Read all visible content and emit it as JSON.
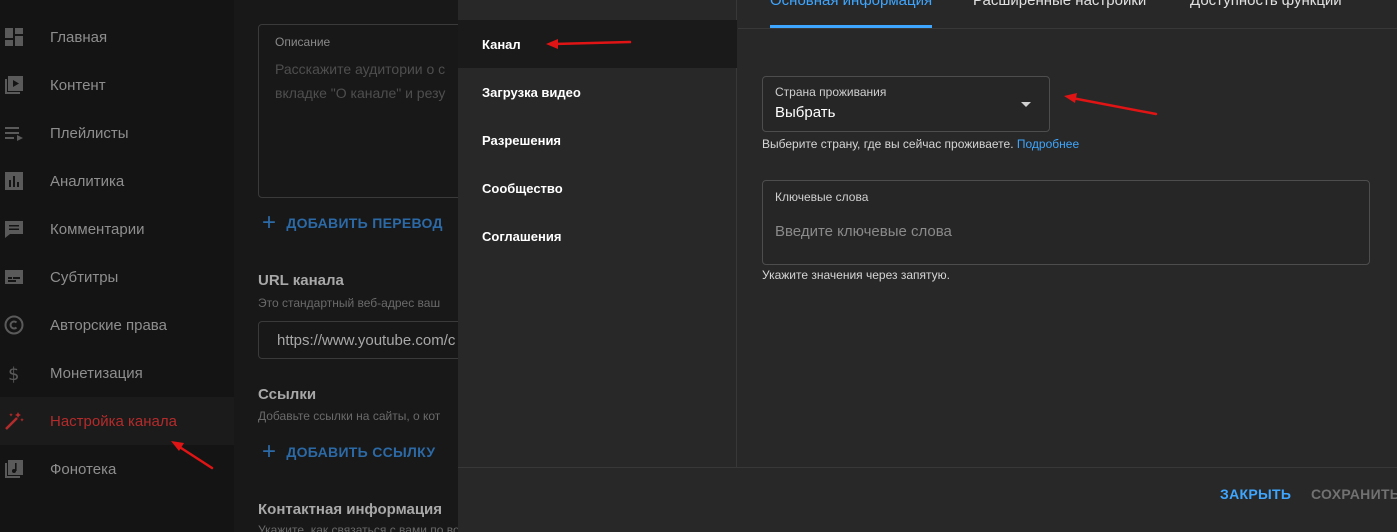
{
  "sidebar": {
    "items": [
      {
        "label": "Главная",
        "icon": "dashboard-icon"
      },
      {
        "label": "Контент",
        "icon": "video-library-icon"
      },
      {
        "label": "Плейлисты",
        "icon": "playlist-icon"
      },
      {
        "label": "Аналитика",
        "icon": "analytics-icon"
      },
      {
        "label": "Комментарии",
        "icon": "comment-icon"
      },
      {
        "label": "Субтитры",
        "icon": "subtitles-icon"
      },
      {
        "label": "Авторские права",
        "icon": "copyright-icon"
      },
      {
        "label": "Монетизация",
        "icon": "dollar-icon"
      },
      {
        "label": "Настройка канала",
        "icon": "magic-wand-icon",
        "active": true
      },
      {
        "label": "Фонотека",
        "icon": "music-library-icon"
      }
    ]
  },
  "background": {
    "description_label": "Описание",
    "description_placeholder_line1": "Расскажите аудитории о с",
    "description_placeholder_line2": "вкладке \"О канале\" и резу",
    "add_translation": "ДОБАВИТЬ ПЕРЕВОД",
    "url_title": "URL канала",
    "url_sub": "Это стандартный веб-адрес ваш",
    "url_value": "https://www.youtube.com/c",
    "links_title": "Ссылки",
    "links_sub": "Добавьте ссылки на сайты, о кот",
    "add_link": "ДОБАВИТЬ ССЫЛКУ",
    "contact_title": "Контактная информация",
    "contact_sub": "Укажите, как связаться с вами по вопросам сотрудничества. Зрители могут увидеть адрес электронной почты на вкладке \"О канале\"."
  },
  "dialog": {
    "nav": [
      {
        "label": "Канал",
        "active": true
      },
      {
        "label": "Загрузка видео"
      },
      {
        "label": "Разрешения"
      },
      {
        "label": "Сообщество"
      },
      {
        "label": "Соглашения"
      }
    ],
    "tabs": [
      {
        "label": "Основная информация",
        "active": true
      },
      {
        "label": "Расширенные настройки"
      },
      {
        "label": "Доступность функций"
      }
    ],
    "country": {
      "label": "Страна проживания",
      "value": "Выбрать",
      "help": "Выберите страну, где вы сейчас проживаете.",
      "help_link": "Подробнее"
    },
    "keywords": {
      "label": "Ключевые слова",
      "placeholder": "Введите ключевые слова",
      "help": "Укажите значения через запятую."
    },
    "buttons": {
      "close": "ЗАКРЫТЬ",
      "save": "СОХРАНИТЬ"
    }
  },
  "colors": {
    "accent": "#3ea6ff",
    "active_nav": "#b42b2b",
    "annotation_arrow": "#e01414"
  }
}
